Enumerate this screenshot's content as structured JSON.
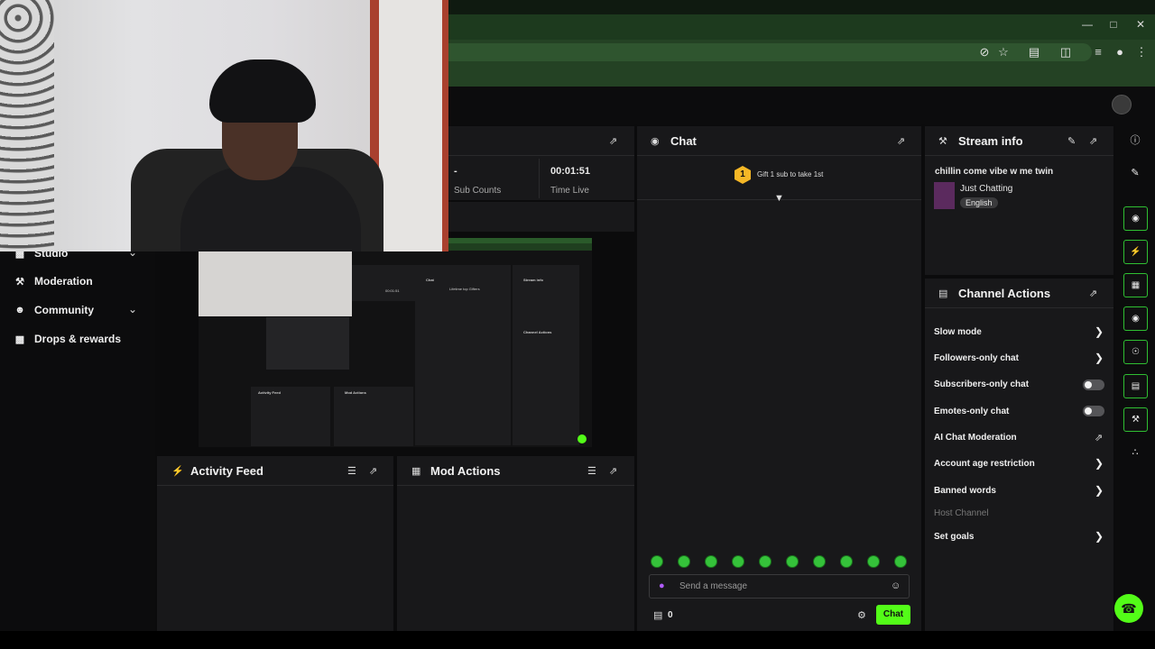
{
  "nav": {
    "studio": "Studio",
    "moderation": "Moderation",
    "community": "Community",
    "drops": "Drops & rewards"
  },
  "stats": {
    "subs_value": "-",
    "subs_label": "Sub Counts",
    "time_value": "00:01:51",
    "time_label": "Time Live"
  },
  "activity": {
    "title": "Activity Feed"
  },
  "mod_actions": {
    "title": "Mod Actions"
  },
  "chat": {
    "title": "Chat",
    "gift_rank": "1",
    "gift_text": "Gift 1 sub to take 1st",
    "placeholder": "Send a message",
    "count": "0",
    "send_label": "Chat"
  },
  "stream_info": {
    "title": "Stream info",
    "stream_title": "chillin come vibe w me twin",
    "category": "Just Chatting",
    "language": "English"
  },
  "channel_actions": {
    "title": "Channel Actions",
    "items": [
      {
        "label": "Slow mode"
      },
      {
        "label": "Followers-only chat"
      },
      {
        "label": "Subscribers-only chat"
      },
      {
        "label": "Emotes-only chat"
      },
      {
        "label": "AI Chat Moderation"
      },
      {
        "label": "Account age restriction"
      },
      {
        "label": "Banned words"
      },
      {
        "label": "Host Channel"
      },
      {
        "label": "Set goals"
      }
    ]
  },
  "mini": {
    "chat": "Chat",
    "stream_info": "Stream info",
    "time": "00:01:51",
    "top_gifters": "Lifetime top Gifters",
    "activity": "Activity Feed",
    "mod_actions": "Mod Actions",
    "channel_actions": "Channel Actions"
  },
  "colors": {
    "accent": "#53fc18",
    "panel": "#18181a",
    "browser": "#244224"
  }
}
